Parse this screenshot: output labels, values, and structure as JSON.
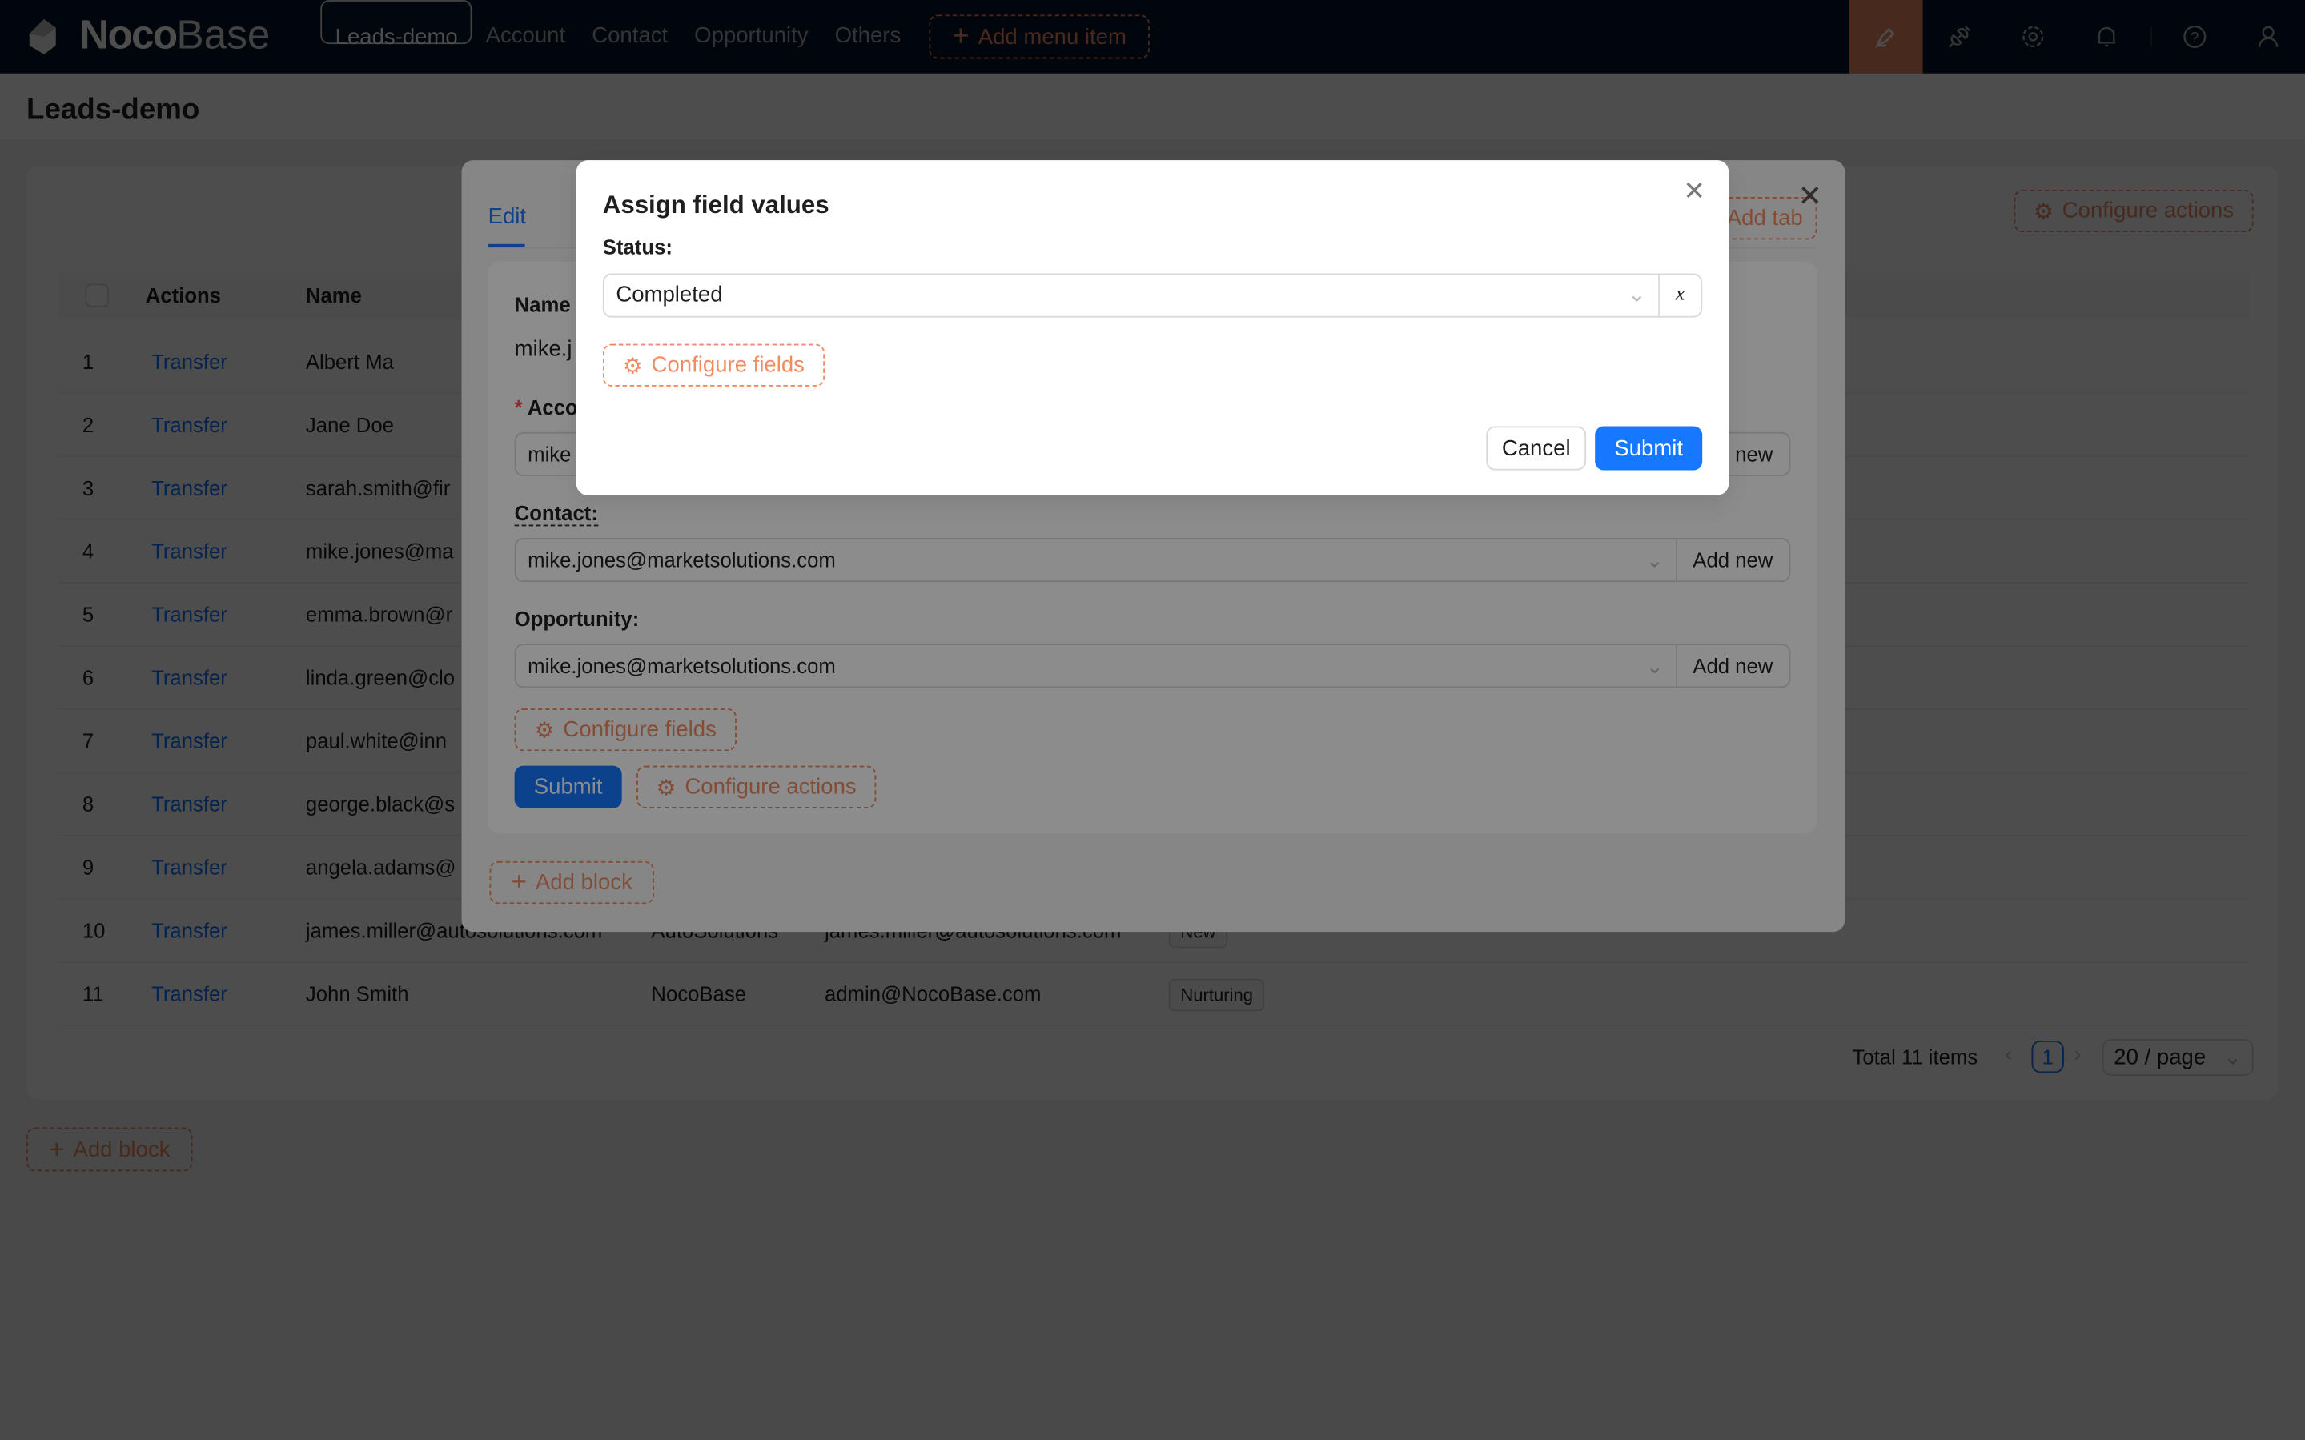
{
  "header": {
    "logo": {
      "part1": "Noco",
      "part2": "Base"
    },
    "menu": [
      {
        "label": "Leads-demo",
        "selected": true
      },
      {
        "label": "Account"
      },
      {
        "label": "Contact"
      },
      {
        "label": "Opportunity"
      },
      {
        "label": "Others"
      }
    ],
    "add_menu_item": "Add menu item",
    "icons": [
      "ui-editor-icon",
      "plugin-icon",
      "settings-icon",
      "bell-icon",
      "help-icon",
      "user-icon"
    ]
  },
  "page": {
    "title": "Leads-demo",
    "configure_actions": "Configure actions",
    "add_block": "Add block",
    "table": {
      "columns": [
        "Actions",
        "Name"
      ],
      "rows": [
        {
          "index": "1",
          "action": "Transfer",
          "name": "Albert Ma"
        },
        {
          "index": "2",
          "action": "Transfer",
          "name": "Jane Doe"
        },
        {
          "index": "3",
          "action": "Transfer",
          "name": "sarah.smith@fir"
        },
        {
          "index": "4",
          "action": "Transfer",
          "name": "mike.jones@ma"
        },
        {
          "index": "5",
          "action": "Transfer",
          "name": "emma.brown@r"
        },
        {
          "index": "6",
          "action": "Transfer",
          "name": "linda.green@clo"
        },
        {
          "index": "7",
          "action": "Transfer",
          "name": "paul.white@inn"
        },
        {
          "index": "8",
          "action": "Transfer",
          "name": "george.black@s"
        },
        {
          "index": "9",
          "action": "Transfer",
          "name": "angela.adams@"
        },
        {
          "index": "10",
          "action": "Transfer",
          "name": "james.miller@autosolutions.com",
          "account": "AutoSolutions",
          "email": "james.miller@autosolutions.com",
          "status": "New"
        },
        {
          "index": "11",
          "action": "Transfer",
          "name": "John Smith",
          "account": "NocoBase",
          "email": "admin@NocoBase.com",
          "status": "Nurturing"
        }
      ]
    },
    "pagination": {
      "total": "Total 11 items",
      "current": "1",
      "page_size": "20 / page"
    }
  },
  "drawer": {
    "tab": "Edit",
    "add_tab": "Add tab",
    "form": {
      "name_label": "Name",
      "name_value": "mike.j",
      "account_label": "Acco",
      "account_value": "mike",
      "account_addon": "new",
      "contact_label": "Contact",
      "contact_value": "mike.jones@marketsolutions.com",
      "contact_addon": "Add new",
      "opportunity_label": "Opportunity",
      "opportunity_value": "mike.jones@marketsolutions.com",
      "opportunity_addon": "Add new",
      "configure_fields": "Configure fields",
      "submit": "Submit",
      "configure_actions": "Configure actions"
    },
    "add_block": "Add block"
  },
  "dialog": {
    "title": "Assign field values",
    "status_label": "Status",
    "status_value": "Completed",
    "variable_button": "x",
    "configure_fields": "Configure fields",
    "cancel": "Cancel",
    "submit": "Submit"
  },
  "colors": {
    "primary": "#1677ff",
    "design_accent": "#f18b62",
    "header_bg": "#001529"
  }
}
